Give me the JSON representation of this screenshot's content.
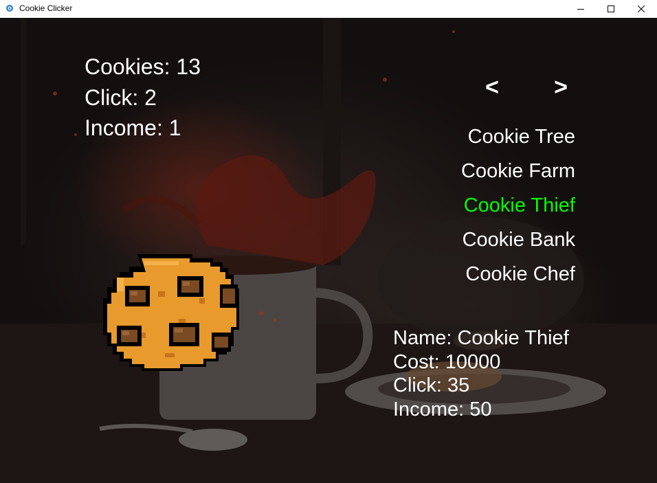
{
  "window": {
    "title": "Cookie Clicker"
  },
  "stats": {
    "cookies": "Cookies: 13",
    "click": "Click: 2",
    "income": "Income: 1"
  },
  "nav": {
    "prev": "<",
    "next": ">"
  },
  "shop": {
    "items": [
      {
        "label": "Cookie Tree"
      },
      {
        "label": "Cookie Farm"
      },
      {
        "label": "Cookie Thief",
        "selected": true
      },
      {
        "label": "Cookie Bank"
      },
      {
        "label": "Cookie Chef"
      }
    ],
    "selected_color": "#00ff00",
    "default_color": "#ffffff"
  },
  "details": {
    "name": "Name: Cookie Thief",
    "cost": "Cost: 10000",
    "click": "Click: 35",
    "income": "Income: 50"
  },
  "icons": {
    "app": "cookie-clicker-app-icon",
    "cookie": "pixel-cookie-icon",
    "minimize": "minimize-icon",
    "maximize": "maximize-icon",
    "close": "close-icon"
  }
}
